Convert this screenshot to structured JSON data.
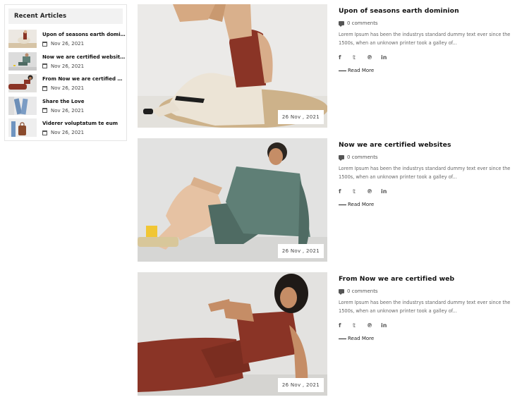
{
  "sidebar": {
    "title": "Recent Articles",
    "items": [
      {
        "title": "Upon of seasons earth dominion",
        "date": "Nov 26, 2021"
      },
      {
        "title": "Now we are certified websites",
        "date": "Nov 26, 2021"
      },
      {
        "title": "From Now we are certified web",
        "date": "Nov 26, 2021"
      },
      {
        "title": "Share the Love",
        "date": "Nov 26, 2021"
      },
      {
        "title": "Viderer voluptatum te eum",
        "date": "Nov 26, 2021"
      }
    ]
  },
  "posts": [
    {
      "title": "Upon of seasons earth dominion",
      "comments": "0 comments",
      "excerpt": "Lorem Ipsum has been the industrys standard dummy text ever since the 1500s, when an unknown printer took a galley of...",
      "date_badge": "26 Nov , 2021",
      "read_more": "Read More"
    },
    {
      "title": "Now we are certified websites",
      "comments": "0 comments",
      "excerpt": "Lorem Ipsum has been the industrys standard dummy text ever since the 1500s, when an unknown printer took a galley of...",
      "date_badge": "26 Nov , 2021",
      "read_more": "Read More"
    },
    {
      "title": "From Now we are certified web",
      "comments": "0 comments",
      "excerpt": "Lorem Ipsum has been the industrys standard dummy text ever since the 1500s, when an unknown printer took a galley of...",
      "date_badge": "26 Nov , 2021",
      "read_more": "Read More"
    }
  ],
  "social": {
    "facebook": "f",
    "twitter": "𝕥",
    "pinterest": "℗",
    "linkedin": "in"
  },
  "icons": [
    "calendar-icon",
    "comment-icon",
    "facebook-icon",
    "twitter-icon",
    "pinterest-icon",
    "linkedin-icon"
  ],
  "colors": {
    "rust": "#8a3426",
    "sage": "#5f7f76",
    "cream": "#ece4d6",
    "background": "#ffffff"
  }
}
